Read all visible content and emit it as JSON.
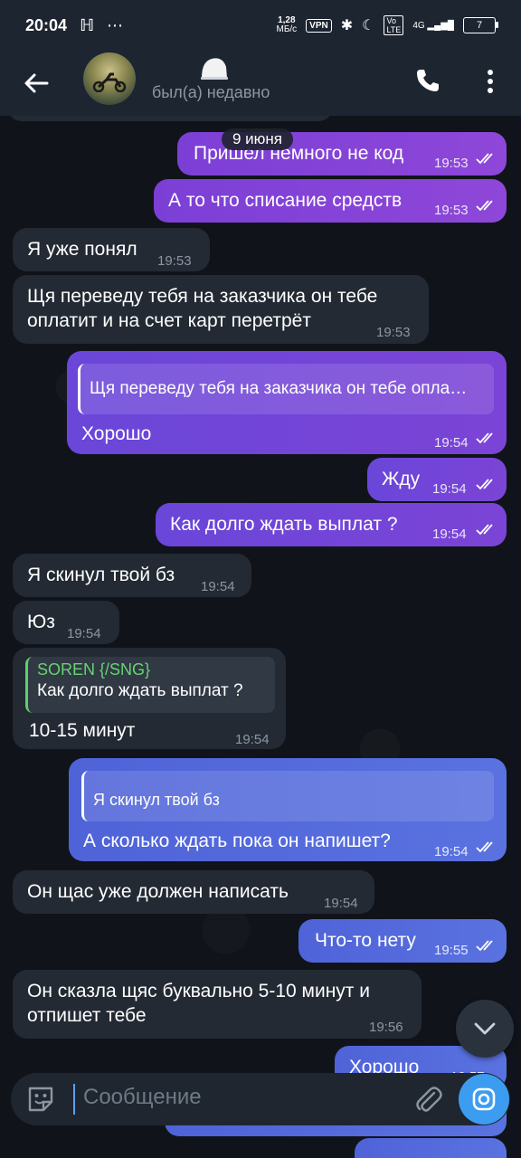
{
  "statusbar": {
    "time": "20:04",
    "speed_value": "1,28",
    "speed_unit": "МБ/с",
    "vpn": "VPN",
    "net": "4G",
    "battery": "7"
  },
  "header": {
    "status": "был(а) недавно"
  },
  "chat": {
    "date_pill": "9 июня",
    "messages": [
      {
        "text": "Пришел немного не код",
        "time": "19:53"
      },
      {
        "text": "А то что списание средств",
        "time": "19:53"
      },
      {
        "text": "Я уже понял",
        "time": "19:53"
      },
      {
        "text_line1": "Щя переведу тебя на заказчика он тебе",
        "text_line2": "оплатит и на счет карт перетрёт",
        "time": "19:53"
      },
      {
        "quote": "Щя переведу тебя на заказчика он тебе опла…",
        "text": "Хорошо",
        "time": "19:54"
      },
      {
        "text": "Жду",
        "time": "19:54"
      },
      {
        "text": "Как долго ждать выплат ?",
        "time": "19:54"
      },
      {
        "text": "Я скинул твой бз",
        "time": "19:54"
      },
      {
        "text": "Юз",
        "time": "19:54"
      },
      {
        "quote_name": "SOREN {/SNG}",
        "quote": "Как долго ждать выплат ?",
        "text": "10-15 минут",
        "time": "19:54"
      },
      {
        "quote": "Я скинул твой бз",
        "text": "А сколько ждать пока он напишет?",
        "time": "19:54"
      },
      {
        "text": "Он щас уже должен написать",
        "time": "19:54"
      },
      {
        "text": "Что-то нету",
        "time": "19:55"
      },
      {
        "text_line1": "Он сказла щяс буквально 5-10 минут и",
        "text_line2": "отпишет тебе",
        "time": "19:56"
      },
      {
        "text": "Хорошо",
        "time": "19:57"
      }
    ]
  },
  "composer": {
    "placeholder": "Сообщение"
  },
  "colors": {
    "incoming": "#232a34",
    "outgoing_purple": "#8e47d8",
    "outgoing_blue": "#5a72e0",
    "accent": "#3c9df0"
  }
}
